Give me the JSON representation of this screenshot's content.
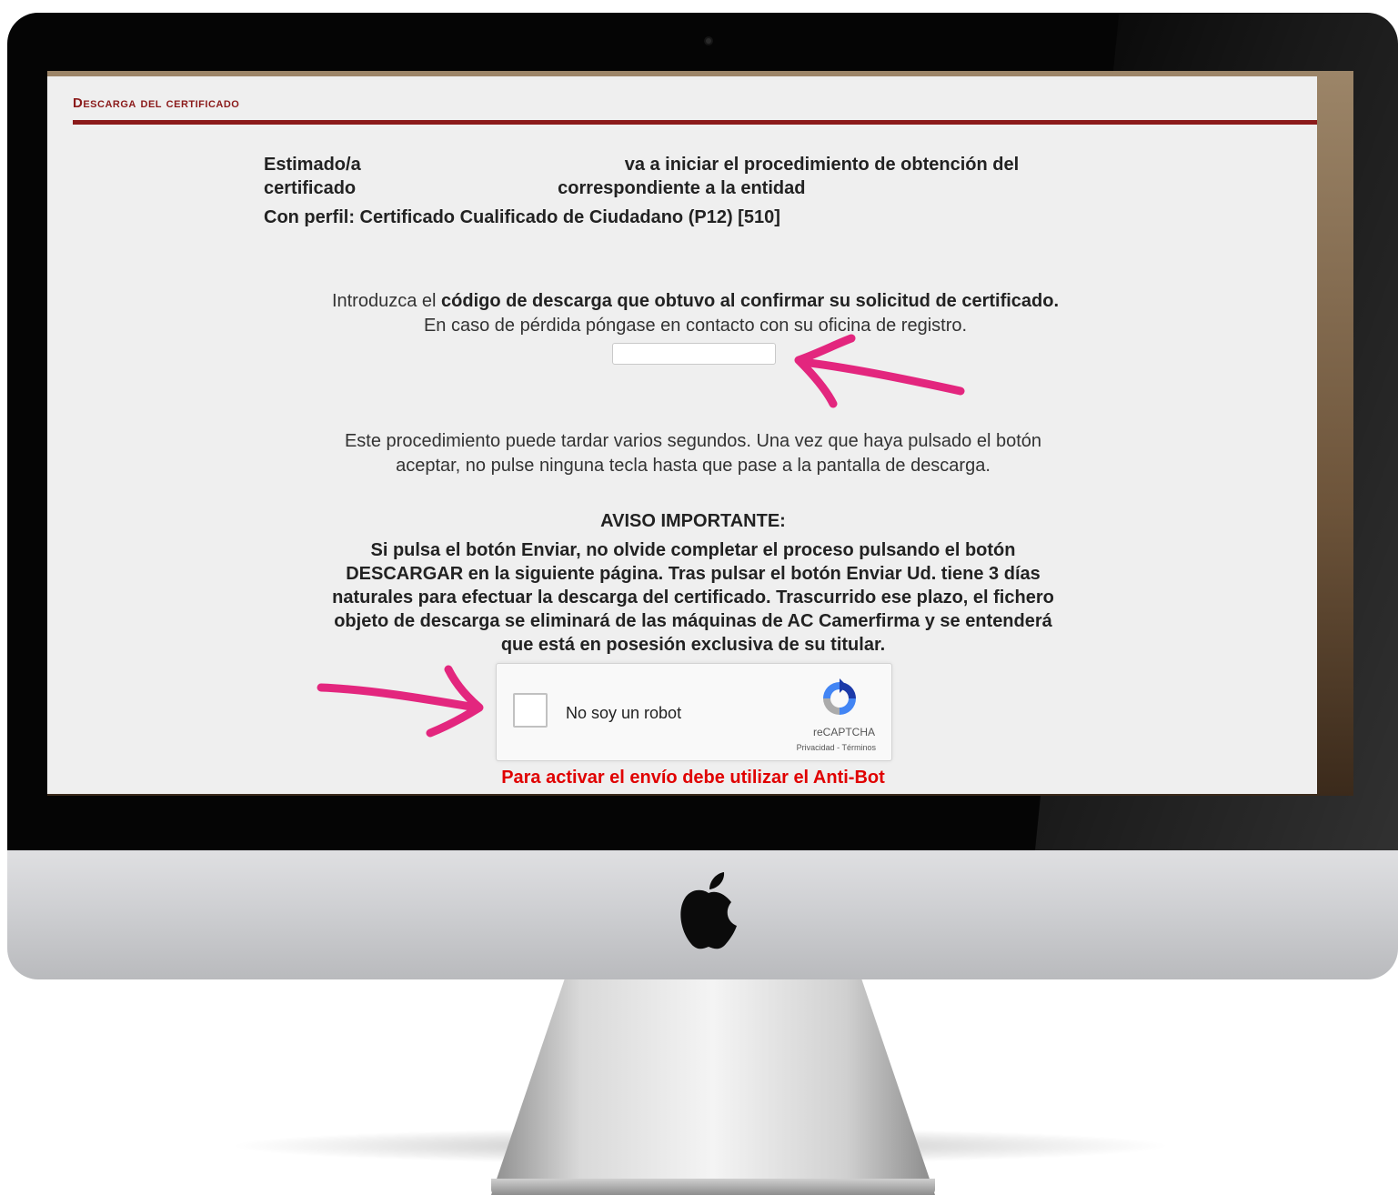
{
  "header": {
    "title": "Descarga del certificado"
  },
  "intro": {
    "line1_start": "Estimado/a",
    "line1_end": "va a iniciar el procedimiento de obtención del",
    "line2_start": "certificado",
    "line2_end": "correspondiente a la entidad",
    "profile": "Con perfil: Certificado Cualificado de Ciudadano (P12) [510]"
  },
  "download_code": {
    "prefix": "Introduzca el ",
    "bold": "código de descarga que obtuvo al confirmar su solicitud de certificado.",
    "help": "En caso de pérdida póngase en contacto con su oficina de registro.",
    "value": ""
  },
  "wait_notice": {
    "line1": "Este procedimiento puede tardar varios segundos. Una vez que haya pulsado el botón",
    "line2": "aceptar, no pulse ninguna tecla hasta que pase a la pantalla de descarga."
  },
  "warning": {
    "title": "AVISO IMPORTANTE:",
    "line1": "Si pulsa el botón Enviar, no olvide completar el proceso pulsando el botón",
    "line2": "DESCARGAR en la siguiente página. Tras pulsar el botón Enviar Ud. tiene 3 días",
    "line3": "naturales para efectuar la descarga del certificado. Trascurrido ese plazo, el fichero",
    "line4": "objeto de descarga se eliminará de las máquinas de AC Camerfirma y se entenderá",
    "line5": "que está en posesión exclusiva de su titular."
  },
  "recaptcha": {
    "label": "No soy un robot",
    "brand": "reCAPTCHA",
    "links": "Privacidad - Términos",
    "checked": false
  },
  "antibot_notice": "Para activar el envío debe utilizar el Anti-Bot",
  "colors": {
    "heading": "#8b1a1a",
    "page_bg": "#efefef",
    "antibot": "#e00000",
    "annotation_arrow": "#e3267e"
  },
  "icons": {
    "logo": "apple-logo",
    "recaptcha": "recaptcha-logo-icon",
    "annotations": "pink-arrow-icon"
  }
}
